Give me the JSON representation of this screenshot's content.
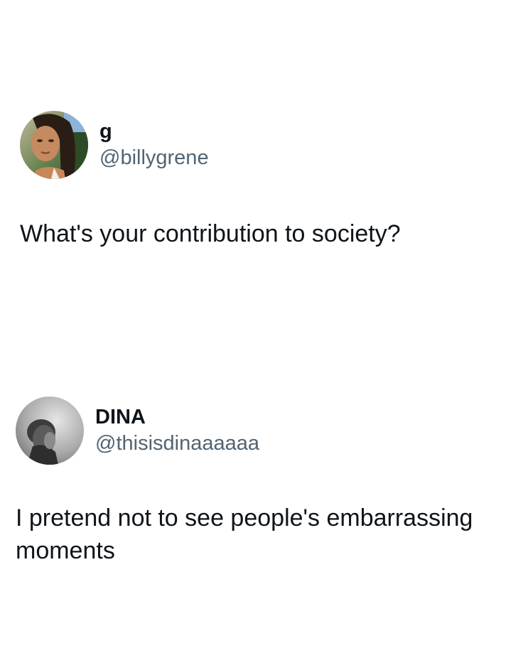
{
  "tweets": [
    {
      "display_name": "g",
      "handle": "@billygrene",
      "text": "What's your contribution to society?",
      "avatar_icon": "avatar-photo-woman"
    },
    {
      "display_name": "DINA",
      "handle": "@thisisdinaaaaaa",
      "text": "I pretend not to see people's embarrassing moments",
      "avatar_icon": "avatar-photo-grayscale"
    }
  ],
  "colors": {
    "text_primary": "#0f1419",
    "text_secondary": "#536471",
    "background": "#ffffff"
  }
}
